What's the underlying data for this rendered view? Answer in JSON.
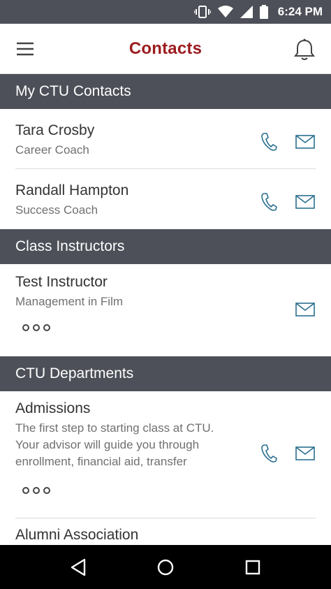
{
  "status_bar": {
    "time": "6:24 PM",
    "icons": [
      "vibrate-icon",
      "wifi-icon",
      "signal-icon",
      "battery-icon"
    ]
  },
  "header": {
    "title": "Contacts",
    "menu_icon": "hamburger-menu-icon",
    "notification_icon": "bell-icon"
  },
  "colors": {
    "brand": "#9b1b1e",
    "section_bg": "#4d5058",
    "action_icon": "#2a6f8f"
  },
  "sections": [
    {
      "title": "My CTU Contacts",
      "contacts": [
        {
          "name": "Tara Crosby",
          "subtitle": "Career Coach"
        },
        {
          "name": "Randall Hampton",
          "subtitle": "Success Coach"
        }
      ]
    },
    {
      "title": "Class Instructors",
      "contacts": [
        {
          "name": "Test Instructor",
          "subtitle": "Management in Film"
        }
      ]
    },
    {
      "title": "CTU Departments",
      "contacts": [
        {
          "name": "Admissions",
          "subtitle": "The first step to starting class at CTU. Your advisor will guide you through enrollment, financial aid, transfer"
        },
        {
          "name": "Alumni Association",
          "subtitle": ""
        }
      ]
    }
  ]
}
